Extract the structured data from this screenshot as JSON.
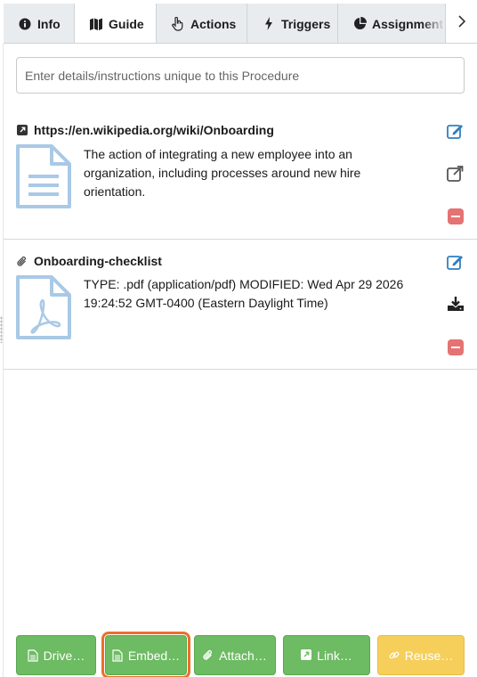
{
  "tabs": [
    {
      "label": "Info",
      "icon": "info-circle-icon"
    },
    {
      "label": "Guide",
      "icon": "map-icon",
      "active": true
    },
    {
      "label": "Actions",
      "icon": "hand-pointer-icon"
    },
    {
      "label": "Triggers",
      "icon": "bolt-icon"
    },
    {
      "label": "Assignment",
      "icon": "pie-chart-icon"
    }
  ],
  "tab_next": "chevron-right-icon",
  "details": {
    "placeholder": "Enter details/instructions unique to this Procedure",
    "value": ""
  },
  "items": [
    {
      "type": "link",
      "title": "https://en.wikipedia.org/wiki/Onboarding",
      "description": "The action of integrating a new employee into an organization, including processes around new hire orientation.",
      "thumb": "document-icon",
      "actions": [
        "edit-icon",
        "external-link-icon",
        "remove-icon"
      ]
    },
    {
      "type": "attachment",
      "title": "Onboarding-checklist",
      "description": "TYPE: .pdf (application/pdf) MODIFIED: Wed Apr 29 2026 19:24:52 GMT-0400 (Eastern Daylight Time)",
      "thumb": "pdf-document-icon",
      "actions": [
        "edit-icon",
        "download-icon",
        "remove-icon"
      ]
    }
  ],
  "footer": {
    "drive_label": "Drive…",
    "embed_label": "Embed…",
    "attach_label": "Attach…",
    "link_label": "Link…",
    "reuse_label": "Reuse…"
  },
  "colors": {
    "primary_green": "#6dbb63",
    "reuse_yellow": "#f6cf5b",
    "focus_orange": "#e8702a",
    "action_blue": "#2f7fc1",
    "remove_red": "#e57373",
    "thumb_blue": "#a9c9e6"
  }
}
